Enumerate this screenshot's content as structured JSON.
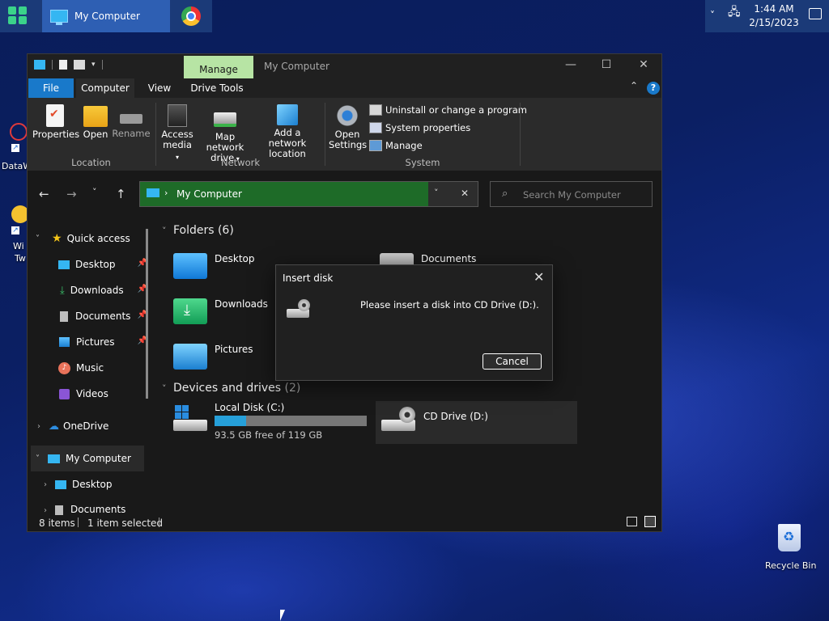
{
  "taskbar": {
    "window_title": "My Computer",
    "time": "1:44 AM",
    "date": "2/15/2023"
  },
  "desktop": {
    "icons": [
      {
        "label": "DataW"
      },
      {
        "label": "Wi"
      },
      {
        "label": "Tw"
      },
      {
        "label": "Recycle Bin"
      }
    ]
  },
  "window": {
    "title": "My Computer",
    "contextual_tab": "Manage",
    "tabs": [
      "File",
      "Computer",
      "View",
      "Drive Tools"
    ],
    "help_label": "?",
    "ribbon": {
      "location": {
        "label": "Location",
        "buttons": [
          "Properties",
          "Open",
          "Rename"
        ]
      },
      "network": {
        "label": "Network",
        "access_media_line1": "Access",
        "access_media_line2": "media",
        "map_drive_line1": "Map network",
        "map_drive_line2": "drive",
        "add_location_line1": "Add a network",
        "add_location_line2": "location"
      },
      "system": {
        "label": "System",
        "open_settings_line1": "Open",
        "open_settings_line2": "Settings",
        "items": [
          "Uninstall or change a program",
          "System properties",
          "Manage"
        ]
      }
    },
    "address": "My Computer",
    "search_placeholder": "Search My Computer",
    "nav": {
      "quick_access": "Quick access",
      "items": [
        "Desktop",
        "Downloads",
        "Documents",
        "Pictures",
        "Music",
        "Videos"
      ],
      "onedrive": "OneDrive",
      "my_computer": "My Computer",
      "sub_items": [
        "Desktop",
        "Documents"
      ]
    },
    "content": {
      "folders_header": "Folders (6)",
      "folders": [
        "Desktop",
        "Documents",
        "Downloads",
        "Pictures"
      ],
      "drives_header": "Devices and drives",
      "drives_count": "(2)",
      "drives": [
        {
          "name": "Local Disk (C:)",
          "free": "93.5 GB free of 119 GB",
          "used_fraction": 0.21
        },
        {
          "name": "CD Drive (D:)"
        }
      ]
    },
    "status": {
      "items": "8 items",
      "selected": "1 item selected"
    }
  },
  "dialog": {
    "title": "Insert disk",
    "message": "Please insert a disk into CD Drive (D:).",
    "cancel": "Cancel"
  },
  "colors": {
    "accent": "#1979ca",
    "manage_tab": "#b7e4a4",
    "address_highlight": "#1e6b28",
    "drive_bar": "#26a0da"
  }
}
